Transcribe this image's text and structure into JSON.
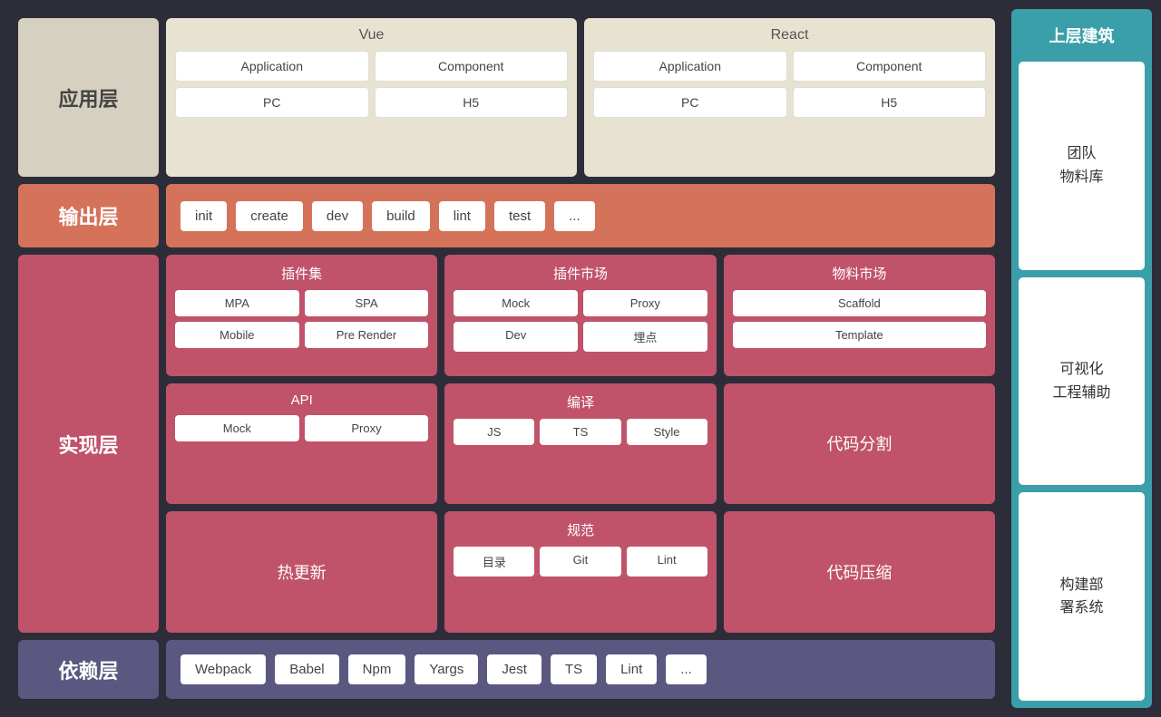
{
  "layers": {
    "app": "应用层",
    "output": "输出层",
    "impl": "实现层",
    "dep": "依赖层"
  },
  "rightColumn": {
    "title": "上层建筑",
    "cards": [
      "团队\n物料库",
      "可视化\n工程辅助",
      "构建部\n署系统"
    ]
  },
  "vue": {
    "title": "Vue",
    "items": [
      "Application",
      "Component",
      "PC",
      "H5"
    ]
  },
  "react": {
    "title": "React",
    "items": [
      "Application",
      "Component",
      "PC",
      "H5"
    ]
  },
  "outputItems": [
    "init",
    "create",
    "dev",
    "build",
    "lint",
    "test",
    "..."
  ],
  "pluginSet": {
    "title": "插件集",
    "items": [
      "MPA",
      "SPA",
      "Mobile",
      "Pre Render"
    ]
  },
  "pluginMarket": {
    "title": "插件市场",
    "items": [
      "Mock",
      "Proxy",
      "Dev",
      "埋点"
    ]
  },
  "materialMarket": {
    "title": "物料市场",
    "items": [
      "Scaffold",
      "Template"
    ]
  },
  "api": {
    "title": "API",
    "items": [
      "Mock",
      "Proxy"
    ]
  },
  "compile": {
    "title": "编译",
    "items": [
      "JS",
      "TS",
      "Style"
    ]
  },
  "codeSplit": "代码分割",
  "hotUpdate": "热更新",
  "spec": {
    "title": "规范",
    "items": [
      "目录",
      "Git",
      "Lint"
    ]
  },
  "codeCompress": "代码压缩",
  "depItems": [
    "Webpack",
    "Babel",
    "Npm",
    "Yargs",
    "Jest",
    "TS",
    "Lint",
    "..."
  ]
}
